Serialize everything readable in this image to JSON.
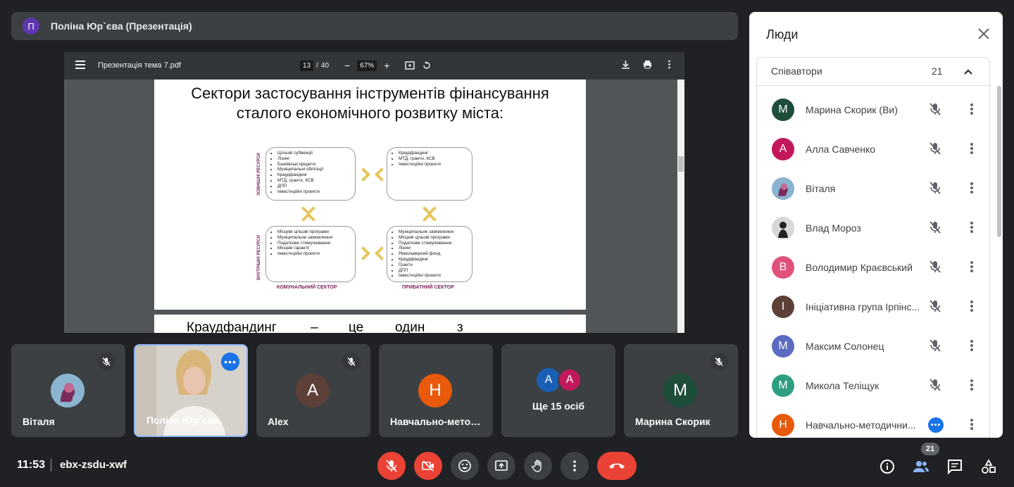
{
  "presenter": {
    "avatar_letter": "П",
    "title": "Поліна Юр`єва (Презентація)"
  },
  "pdf": {
    "filename": "Презентація тема 7.pdf",
    "page_current": "13",
    "page_sep": "/",
    "page_total": "40",
    "zoom_minus": "−",
    "zoom": "67%",
    "zoom_plus": "+"
  },
  "slide": {
    "title_line1": "Сектори застосування інструментів фінансування",
    "title_line2": "сталого економічного розвитку міста:",
    "label_external": "ЗОВНІШНІ РЕСУРСИ",
    "label_internal": "ВНУТРІШНІ РЕСУРСИ",
    "label_communal": "КОМУНАЛЬНИЙ СЕКТОР",
    "label_private": "ПРИВАТНИЙ СЕКТОР",
    "box_tl": [
      "Цільові субвенції",
      "Лізинг",
      "Банківські кредити",
      "Муніципальні облігації",
      "Краудфандинг",
      "МТД, гранти, КСВ",
      "ДПП",
      "Інвестиційні проекти"
    ],
    "box_tr": [
      "Краудфандинг",
      "МТД, гранти, КСВ",
      "Інвестиційні проекти"
    ],
    "box_bl": [
      "Місцеві цільові програми",
      "Муніципальне замовлення",
      "Податкове стимулювання",
      "Місцеві гарантії",
      "Інвестиційні проекти"
    ],
    "box_br": [
      "Муніципальне замовлення",
      "Місцеві цільові програми",
      "Податкове стимулювання",
      "Лізинг",
      "Револьверний фонд",
      "Краудфандинг",
      "Гранти",
      "ДПП",
      "Інвестиційні проекти"
    ]
  },
  "slide2": {
    "w1": "Краудфандинг",
    "w2": "–",
    "w3": "це",
    "w4": "один",
    "w5": "з"
  },
  "tiles": [
    {
      "name": "Віталя"
    },
    {
      "name": "Поліна Юр`єва"
    },
    {
      "name": "Alex",
      "letter": "A",
      "color": "#5d4037"
    },
    {
      "name": "Навчально-мето…",
      "letter": "Н",
      "color": "#e8590c"
    },
    {
      "name": "Ще 15 осіб",
      "letter1": "A",
      "letter2": "A"
    },
    {
      "name": "Марина Скорик",
      "letter": "M",
      "color": "#1e4d3a"
    }
  ],
  "meeting": {
    "time": "11:53",
    "code": "ebx-zsdu-xwf"
  },
  "people_badge": "21",
  "people": {
    "title": "Люди",
    "group_label": "Співавтори",
    "group_count": "21",
    "list": [
      {
        "name": "Марина Скорик (Ви)",
        "letter": "M",
        "color": "#1e4d3a"
      },
      {
        "name": "Алла Савченко",
        "letter": "A",
        "color": "#c2185b"
      },
      {
        "name": "Віталя",
        "letter": "",
        "color": "#6b8fa8"
      },
      {
        "name": "Влад Мороз",
        "letter": "",
        "color": "#cfcfcf"
      },
      {
        "name": "Володимир Краєвський",
        "letter": "B",
        "color": "#e0527a"
      },
      {
        "name": "Ініціативна група Ірпінс...",
        "letter": "I",
        "color": "#5d4037"
      },
      {
        "name": "Максим Солонец",
        "letter": "M",
        "color": "#5c6bc0"
      },
      {
        "name": "Микола Теліщук",
        "letter": "M",
        "color": "#2e9e82"
      },
      {
        "name": "Навчально-методични...",
        "letter": "H",
        "color": "#e8590c"
      }
    ]
  }
}
